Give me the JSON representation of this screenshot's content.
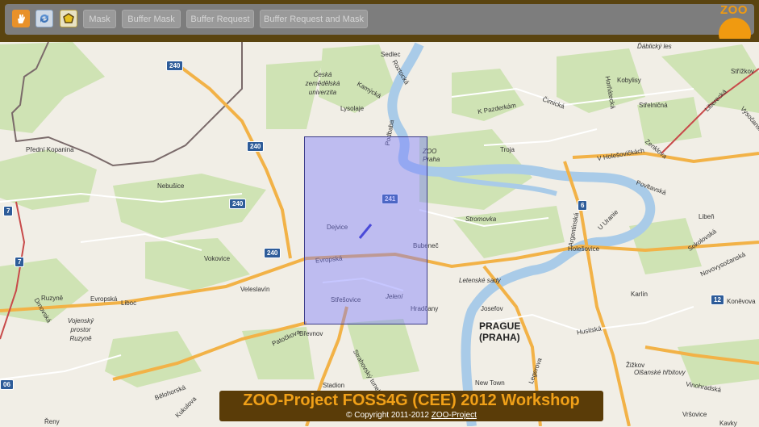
{
  "toolbar": {
    "tools": [
      {
        "icon": "hand-pan-icon",
        "color": "#e8912a"
      },
      {
        "icon": "refresh-icon",
        "color": "#5a8fd0"
      },
      {
        "icon": "polygon-select-icon",
        "color": "#e6c020"
      }
    ],
    "buttons": [
      "Mask",
      "Buffer Mask",
      "Buffer Request",
      "Buffer Request and Mask"
    ],
    "logo_text": "ZOO"
  },
  "map": {
    "labels": {
      "sedlec": "Sedlec",
      "ceska_zemedelska": "Česká zemědělská univerzita",
      "kamycka": "Kamýcká",
      "lysolaje": "Lysolaje",
      "roztocka": "Roztocká",
      "podbaba": "Podbaba",
      "zoo_praha": "ZOO Praha",
      "troja": "Troja",
      "k_pazderkam": "K Pazderkám",
      "cimicka": "Čimická",
      "kobylisy": "Kobylisy",
      "hortadlecka": "Horňátecká",
      "strelnicna": "Střelničná",
      "dablicky_les": "Ďáblický les",
      "strizkov": "Střížkov",
      "liberecka": "Liberecká",
      "vysocanska": "Vysočanská",
      "zenklova": "Zenklova",
      "v_holesovickach": "V Holešovičkách",
      "povltavska": "Povltavská",
      "u_uranie": "U Uranie",
      "liben": "Libeň",
      "sokolovska": "Sokolovská",
      "novovysocanska": "Novovysočanská",
      "argentinska": "Argentinská",
      "holesovice": "Holešovice",
      "karlin": "Karlín",
      "konevova": "Koněvova",
      "stromovka": "Stromovka",
      "letenske_sady": "Letenské sady",
      "josefov": "Josefov",
      "prague": "PRAGUE (PRAHA)",
      "husitska": "Husitská",
      "zizkov": "Žižkov",
      "olsanske": "Olšanské hřbitovy",
      "vinohradska": "Vinohradská",
      "vrsovice": "Vršovice",
      "new_town": "New Town",
      "legerova": "Legerova",
      "predni_kopanina": "Přední Kopanina",
      "nebusice": "Nebušice",
      "vokovice": "Vokovice",
      "veleslavin": "Veleslavín",
      "ruzyne": "Ruzyně",
      "evropska": "Evropská",
      "liboc": "Liboc",
      "vojensky_prostor": "Vojenský prostor Ruzyně",
      "drnovska": "Drnovská",
      "dejvice": "Dejvice",
      "bubenec": "Bubeneč",
      "evropska2": "Evropská",
      "strepsovice": "Střešovice",
      "jelení": "Jelení",
      "hradcany": "Hradčany",
      "patockova": "Patočkova",
      "brevnov": "Břevnov",
      "strahovsky": "Strahovský tunel",
      "belohorska": "Bělohorská",
      "kukulova": "Kukulova",
      "stadion": "Stadion",
      "reny": "Řeny",
      "kavky": "Kavky"
    },
    "shields": [
      "240",
      "240",
      "240",
      "240",
      "241",
      "6",
      "7",
      "7",
      "12",
      "06"
    ]
  },
  "footer": {
    "title": "ZOO-Project FOSS4G (CEE) 2012 Workshop",
    "copyright": "© Copyright 2011-2012 ",
    "link": "ZOO-Project"
  }
}
